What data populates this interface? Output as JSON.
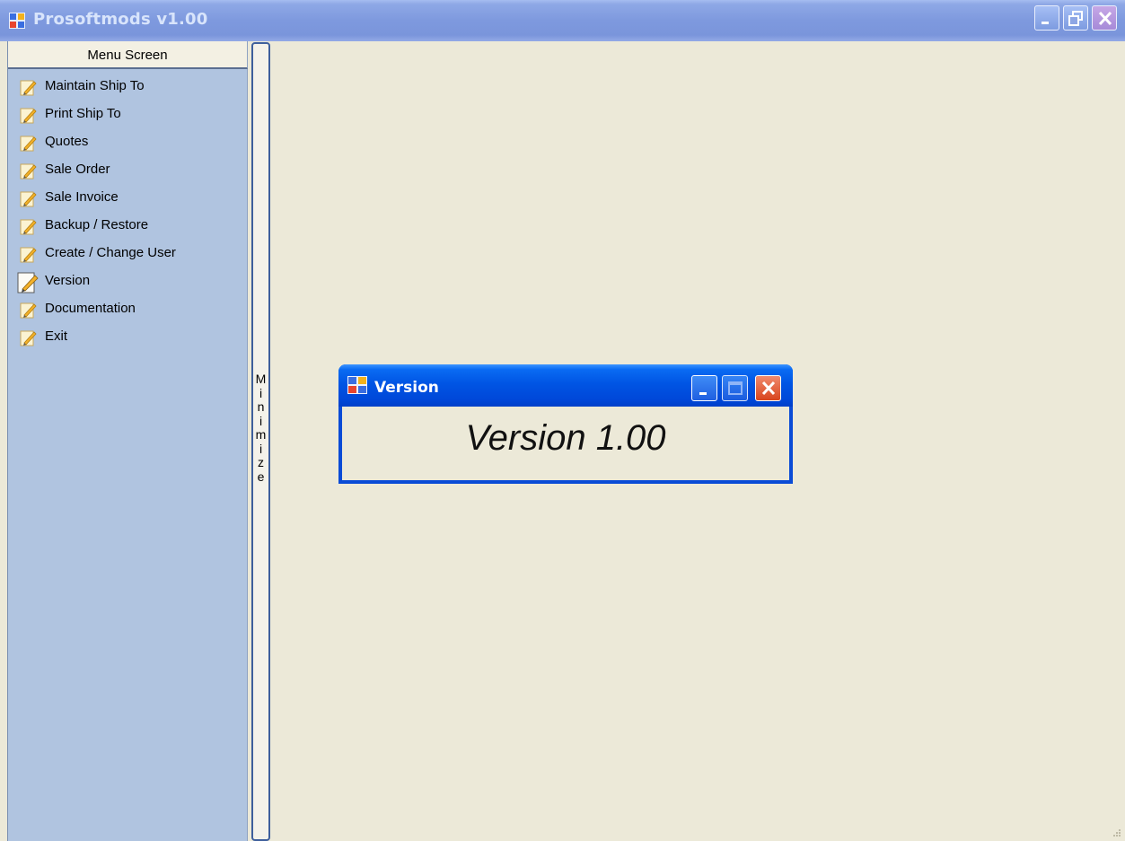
{
  "window": {
    "title": "Prosoftmods v1.00"
  },
  "menu": {
    "header": "Menu Screen",
    "items": [
      {
        "label": "Maintain Ship To"
      },
      {
        "label": "Print Ship To"
      },
      {
        "label": "Quotes"
      },
      {
        "label": "Sale Order"
      },
      {
        "label": "Sale Invoice"
      },
      {
        "label": "Backup / Restore"
      },
      {
        "label": "Create / Change User"
      },
      {
        "label": "Version",
        "selected": true
      },
      {
        "label": "Documentation"
      },
      {
        "label": "Exit"
      }
    ]
  },
  "splitter": {
    "label": "M\ni\nn\ni\nm\ni\nz\ne"
  },
  "dialog": {
    "title": "Version",
    "body_text": "Version 1.00"
  },
  "icons": {
    "app": "app-window-icon",
    "menu_item": "edit-pencil-icon",
    "minimize": "minimize-icon",
    "restore": "restore-icon",
    "maximize": "maximize-icon",
    "close": "close-icon"
  },
  "colors": {
    "titlebar_inactive": "#7e99de",
    "dialog_titlebar": "#0055e4",
    "menu_bg": "#b0c4e0",
    "workspace_bg": "#ece9d8",
    "close_red": "#d8441c"
  }
}
